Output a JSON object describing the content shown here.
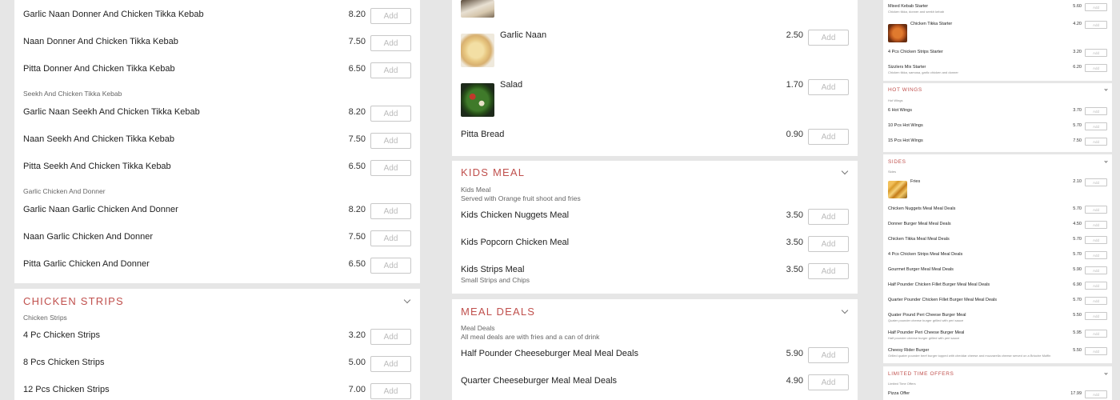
{
  "button_label": "Add",
  "col1": {
    "items_top": [
      {
        "name": "Garlic Naan Donner And Chicken Tikka Kebab",
        "price": "8.20"
      },
      {
        "name": "Naan Donner And Chicken Tikka Kebab",
        "price": "7.50"
      },
      {
        "name": "Pitta Donner And Chicken Tikka Kebab",
        "price": "6.50"
      }
    ],
    "group_seekh": "Seekh And Chicken Tikka Kebab",
    "items_seekh": [
      {
        "name": "Garlic Naan Seekh And Chicken Tikka Kebab",
        "price": "8.20"
      },
      {
        "name": "Naan Seekh And Chicken Tikka Kebab",
        "price": "7.50"
      },
      {
        "name": "Pitta Seekh And Chicken Tikka Kebab",
        "price": "6.50"
      }
    ],
    "group_garlic": "Garlic Chicken And Donner",
    "items_garlic": [
      {
        "name": "Garlic Naan Garlic Chicken And Donner",
        "price": "8.20"
      },
      {
        "name": "Naan Garlic Chicken And Donner",
        "price": "7.50"
      },
      {
        "name": "Pitta Garlic Chicken And Donner",
        "price": "6.50"
      }
    ],
    "strips_title": "Chicken Strips",
    "strips_sub": "Chicken Strips",
    "items_strips": [
      {
        "name": "4 Pc Chicken Strips",
        "price": "3.20"
      },
      {
        "name": "8 Pcs Chicken Strips",
        "price": "5.00"
      },
      {
        "name": "12 Pcs Chicken Strips",
        "price": "7.00"
      }
    ]
  },
  "col2": {
    "items_top": [
      {
        "name": "Garlic Naan",
        "price": "2.50"
      },
      {
        "name": "Salad",
        "price": "1.70"
      },
      {
        "name": "Pitta Bread",
        "price": "0.90"
      }
    ],
    "kids_title": "Kids Meal",
    "kids_sub": "Kids Meal",
    "kids_desc": "Served with Orange fruit shoot and fries",
    "items_kids": [
      {
        "name": "Kids Chicken Nuggets Meal",
        "price": "3.50",
        "desc": ""
      },
      {
        "name": "Kids Popcorn Chicken Meal",
        "price": "3.50",
        "desc": ""
      },
      {
        "name": "Kids Strips Meal",
        "price": "3.50",
        "desc": "Small Strips and Chips"
      }
    ],
    "deals_title": "Meal Deals",
    "deals_sub": "Meal Deals",
    "deals_desc": "All meal deals are with fries and a can of drink",
    "items_deals": [
      {
        "name": "Half Pounder Cheeseburger Meal Meal Deals",
        "price": "5.90"
      },
      {
        "name": "Quarter Cheeseburger Meal Meal Deals",
        "price": "4.90"
      }
    ]
  },
  "col3": {
    "items_top": [
      {
        "name": "Mixed Kebab Starter",
        "price": "5.60",
        "desc": "Chicken tikka, donner and seekh kebab"
      },
      {
        "name": "Chicken Tikka Starter",
        "price": "4.20",
        "desc": ""
      },
      {
        "name": "4 Pcs Chicken Strips Starter",
        "price": "3.20",
        "desc": ""
      },
      {
        "name": "Sizzlers Mix Starter",
        "price": "6.20",
        "desc": "Chicken tikka, samosa, garlic chicken and donner"
      }
    ],
    "wings_title": "Hot Wings",
    "wings_sub": "Hot Wings",
    "items_wings": [
      {
        "name": "6 Hot Wings",
        "price": "3.70"
      },
      {
        "name": "10 Pcs Hot Wings",
        "price": "5.70"
      },
      {
        "name": "15 Pcs Hot Wings",
        "price": "7.50"
      }
    ],
    "sides_title": "Sides",
    "sides_sub": "Sides",
    "items_sides": [
      {
        "name": "Fries",
        "price": "2.10"
      },
      {
        "name": "Chicken Nuggets Meal Meal Deals",
        "price": "5.70"
      },
      {
        "name": "Donner Burger Meal Meal Deals",
        "price": "4.50"
      },
      {
        "name": "Chicken Tikka Meal Meal Deals",
        "price": "5.70"
      },
      {
        "name": "4 Pcs Chicken Strips Meal Meal Deals",
        "price": "5.70"
      },
      {
        "name": "Gourmet Burger Meal Meal Deals",
        "price": "5.90"
      },
      {
        "name": "Half Pounder Chicken Fillet Burger Meal Meal Deals",
        "price": "6.90"
      },
      {
        "name": "Quarter Pounder Chicken Fillet Burger Meal Meal Deals",
        "price": "5.70"
      },
      {
        "name": "Quater Pound Peri Cheese Burger Meal",
        "price": "5.50",
        "desc": "Quater pounder cheese burger grilled with peri sauce"
      },
      {
        "name": "Half Pounder Peri Cheese Burger Meal",
        "price": "5.95",
        "desc": "Half pounder cheese burger grilled with peri sauce"
      },
      {
        "name": "Cheesy Rider Burger",
        "price": "5.50",
        "desc": "Grilled quater pounder beef burger topped with cheddar cheese and mozzarella cheese served on a Brioche Muffin"
      }
    ],
    "ltd_title": "Limited Time Offers",
    "ltd_sub": "Limited Time Offers",
    "items_ltd": [
      {
        "name": "Pizza Offer",
        "price": "17.99"
      }
    ]
  }
}
